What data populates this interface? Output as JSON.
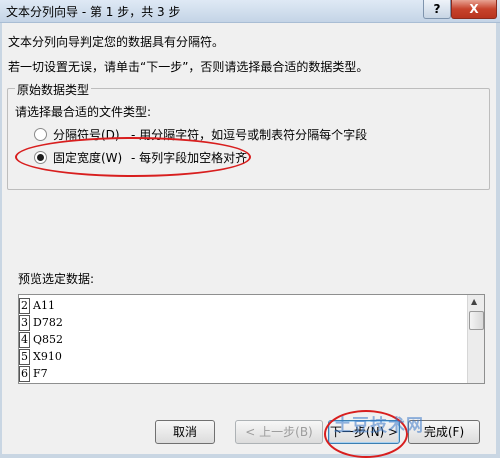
{
  "window": {
    "title": "文本分列向导 - 第 1 步，共 3 步",
    "help_label": "?",
    "close_label": "X"
  },
  "intro": {
    "line1": "文本分列向导判定您的数据具有分隔符。",
    "line2": "若一切设置无误，请单击“下一步”，否则请选择最合适的数据类型。"
  },
  "data_type": {
    "legend": "原始数据类型",
    "prompt": "请选择最合适的文件类型:",
    "options": [
      {
        "label": "分隔符号(D)",
        "description": "- 用分隔字符，如逗号或制表符分隔每个字段",
        "checked": false
      },
      {
        "label": "固定宽度(W)",
        "description": "- 每列字段加空格对齐",
        "checked": true
      }
    ]
  },
  "preview": {
    "label": "预览选定数据:",
    "rows": [
      {
        "num": "2",
        "text": "A11"
      },
      {
        "num": "3",
        "text": "D782"
      },
      {
        "num": "4",
        "text": "Q852"
      },
      {
        "num": "5",
        "text": "X910"
      },
      {
        "num": "6",
        "text": "F7"
      }
    ]
  },
  "buttons": {
    "cancel": "取消",
    "back": "< 上一步(B)",
    "next": "下一步(N) >",
    "finish": "完成(F)"
  },
  "watermark": "土豆技术网",
  "colors": {
    "annotation_red": "#d81e1e",
    "dialog_bg": "#f0f0f0",
    "titlebar_bg": "#c4d4e6"
  }
}
